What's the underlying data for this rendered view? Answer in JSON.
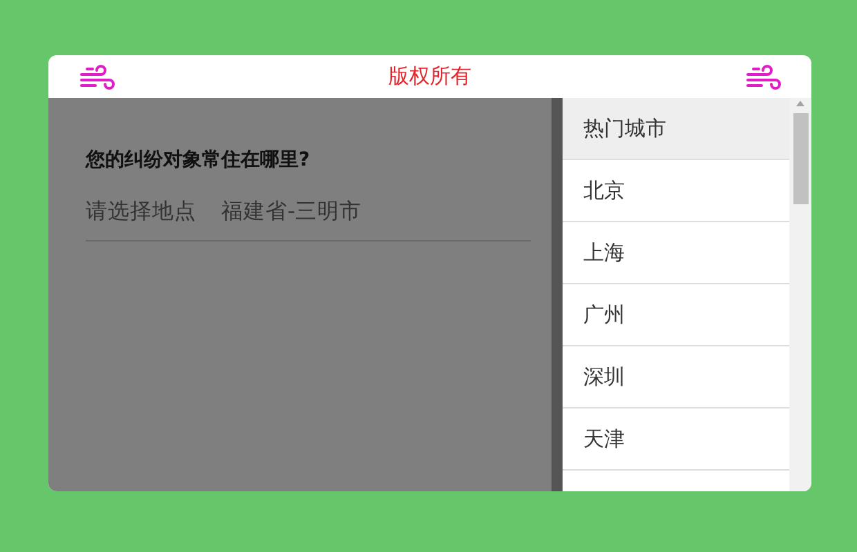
{
  "header": {
    "title": "版权所有"
  },
  "form": {
    "question": "您的纠纷对象常住在哪里?",
    "field_label": "请选择地点",
    "field_value": "福建省-三明市"
  },
  "city_list": [
    {
      "kind": "header",
      "label": "热门城市"
    },
    {
      "kind": "city",
      "label": "北京"
    },
    {
      "kind": "city",
      "label": "上海"
    },
    {
      "kind": "city",
      "label": "广州"
    },
    {
      "kind": "city",
      "label": "深圳"
    },
    {
      "kind": "city",
      "label": "天津"
    }
  ]
}
